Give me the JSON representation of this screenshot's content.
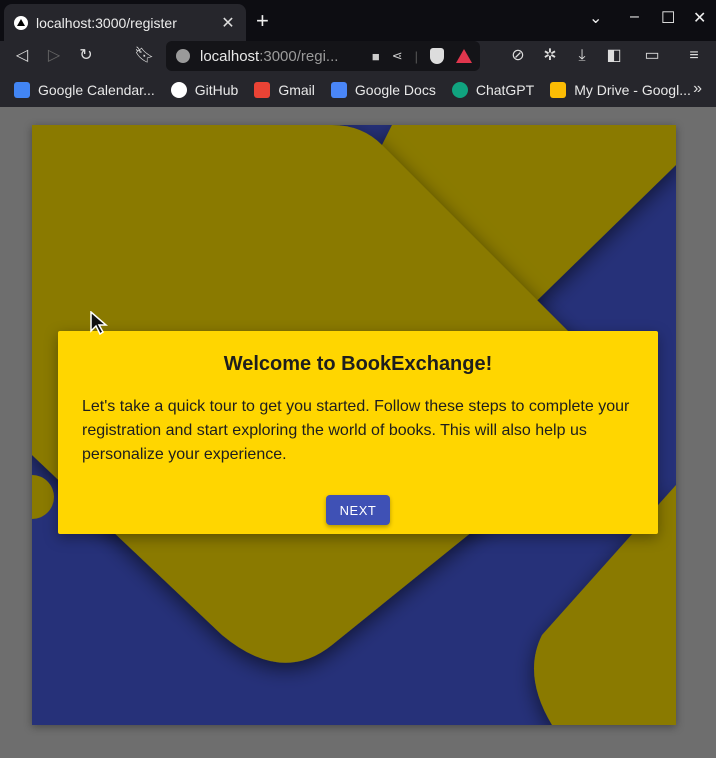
{
  "browser": {
    "tab_title": "localhost:3000/register",
    "tab_close": "✕",
    "new_tab": "+",
    "url_host": "localhost",
    "url_path": ":3000/regi...",
    "window_controls": [
      "⌄",
      "–",
      "☐",
      "✕"
    ],
    "bookmarks": [
      {
        "label": "Google Calendar...",
        "icon": "google-calendar-icon",
        "color": "#4285f4"
      },
      {
        "label": "GitHub",
        "icon": "github-icon",
        "color": "#ffffff"
      },
      {
        "label": "Gmail",
        "icon": "gmail-icon",
        "color": "#ea4335"
      },
      {
        "label": "Google Docs",
        "icon": "google-docs-icon",
        "color": "#4a86f7"
      },
      {
        "label": "ChatGPT",
        "icon": "chatgpt-icon",
        "color": "#10a37f"
      },
      {
        "label": "My Drive - Googl...",
        "icon": "google-drive-icon",
        "color": "#fbbc04"
      }
    ],
    "bookmarks_more": "»"
  },
  "dialog": {
    "title": "Welcome to BookExchange!",
    "body": "Let's take a quick tour to get you started. Follow these steps to complete your registration and start exploring the world of books. This will also help us personalize your experience.",
    "next_label": "NEXT"
  },
  "colors": {
    "background_blue": "#263179",
    "shape_yellow": "#8a7a00",
    "dialog_yellow": "#ffd600",
    "button_blue": "#3f51b5"
  }
}
